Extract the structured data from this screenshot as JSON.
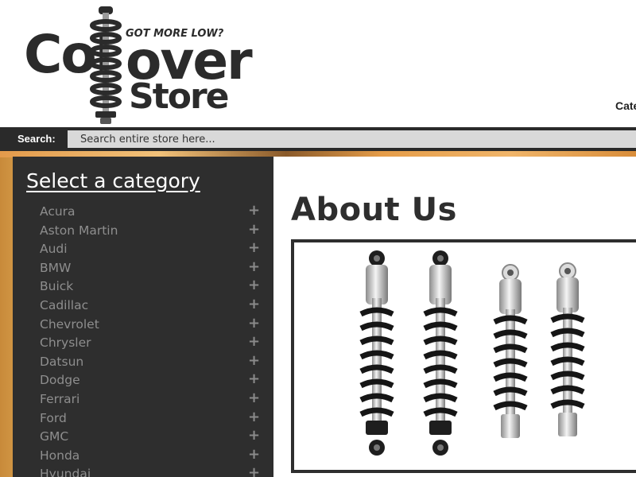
{
  "header": {
    "logo": {
      "word_left": "Coi",
      "word_right": "over",
      "word_bottom": "Store",
      "tagline": "GOT MORE LOW?"
    },
    "nav_partial": "Cate"
  },
  "search": {
    "label": "Search:",
    "placeholder": "Search entire store here..."
  },
  "sidebar": {
    "title": "Select a category",
    "expand_icon": "plus-icon",
    "items": [
      {
        "label": "Acura"
      },
      {
        "label": "Aston Martin"
      },
      {
        "label": "Audi"
      },
      {
        "label": "BMW"
      },
      {
        "label": "Buick"
      },
      {
        "label": "Cadillac"
      },
      {
        "label": "Chevrolet"
      },
      {
        "label": "Chrysler"
      },
      {
        "label": "Datsun"
      },
      {
        "label": "Dodge"
      },
      {
        "label": "Ferrari"
      },
      {
        "label": "Ford"
      },
      {
        "label": "GMC"
      },
      {
        "label": "Honda"
      },
      {
        "label": "Hyundai"
      }
    ]
  },
  "main": {
    "title": "About Us",
    "image": "coilover-shocks-product-photo"
  },
  "colors": {
    "header_bar": "#2a2a2a",
    "sidebar_bg": "#2e2e2e",
    "search_field": "#d9d9d9",
    "category_text": "#8e8e8e",
    "title_text": "#2e2e2e"
  }
}
